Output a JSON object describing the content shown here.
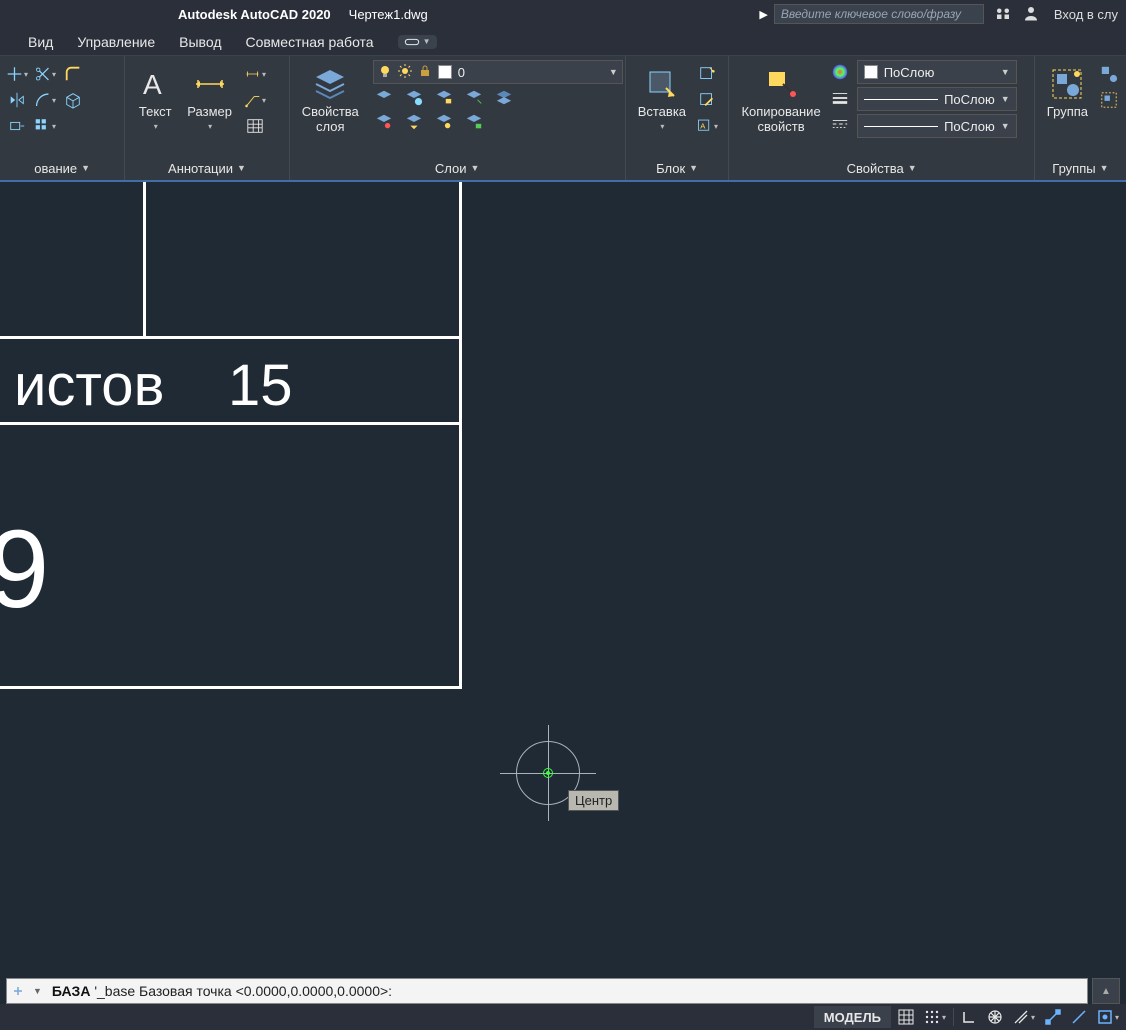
{
  "title": {
    "app": "Autodesk AutoCAD 2020",
    "doc": "Чертеж1.dwg",
    "search_placeholder": "Введите ключевое слово/фразу",
    "signin": "Вход в слу"
  },
  "menu": {
    "view": "Вид",
    "manage": "Управление",
    "output": "Вывод",
    "collab": "Совместная работа"
  },
  "ribbon": {
    "panel_draw": "ование",
    "panel_annot": "Аннотации",
    "panel_layers": "Слои",
    "panel_block": "Блок",
    "panel_props": "Свойства",
    "panel_groups": "Группы",
    "text_btn": "Текст",
    "dim_btn": "Размер",
    "layerprops_btn_l1": "Свойства",
    "layerprops_btn_l2": "слоя",
    "layer_current_name": "0",
    "insert_btn": "Вставка",
    "matchprop_l1": "Копирование",
    "matchprop_l2": "свойств",
    "prop_color": "ПоСлою",
    "prop_lw": "ПоСлою",
    "prop_lt": "ПоСлою",
    "group_btn": "Группа"
  },
  "canvas": {
    "text_istov": "истов",
    "text_15": "15",
    "text_9": "9",
    "tooltip": "Центр"
  },
  "cmd": {
    "label": "БАЗА",
    "text": "'_base Базовая точка <0.0000,0.0000,0.0000>:"
  },
  "status": {
    "model": "МОДЕЛЬ"
  }
}
